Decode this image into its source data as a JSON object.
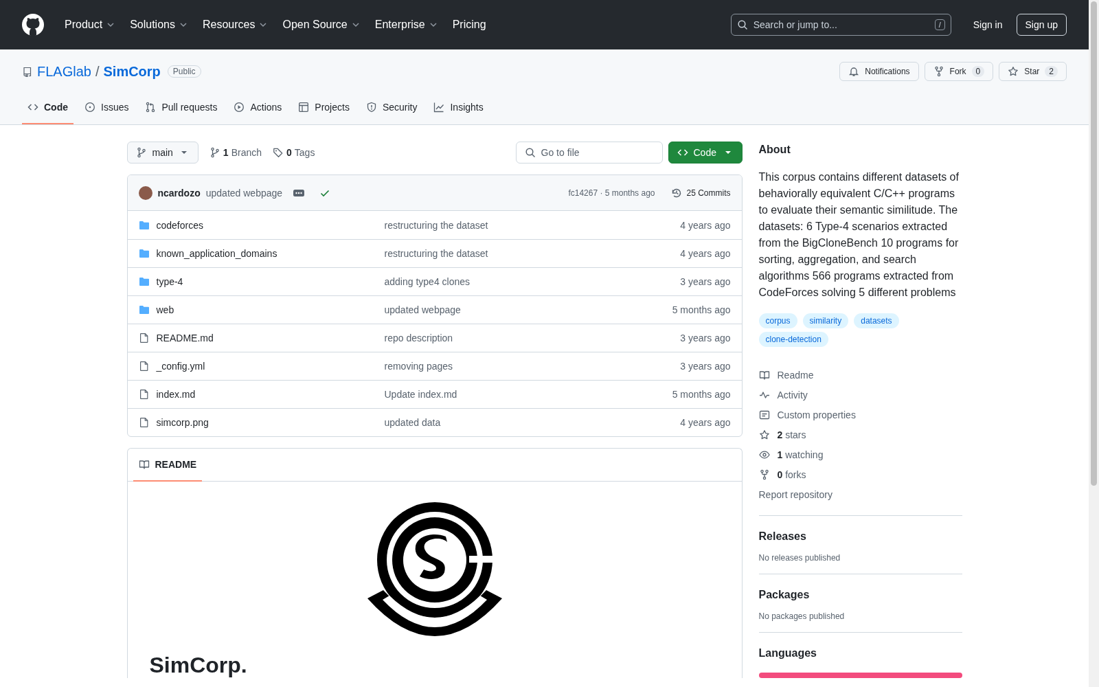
{
  "header": {
    "nav": [
      {
        "label": "Product",
        "menu": true
      },
      {
        "label": "Solutions",
        "menu": true
      },
      {
        "label": "Resources",
        "menu": true
      },
      {
        "label": "Open Source",
        "menu": true
      },
      {
        "label": "Enterprise",
        "menu": true
      },
      {
        "label": "Pricing",
        "menu": false
      }
    ],
    "search": {
      "placeholder": "Search or jump to...",
      "shortcut": "/"
    },
    "sign_in": "Sign in",
    "sign_up": "Sign up"
  },
  "repo": {
    "owner": "FLAGlab",
    "separator": "/",
    "name": "SimCorp",
    "visibility": "Public",
    "actions": [
      {
        "kind": "notifications",
        "label": "Notifications"
      },
      {
        "kind": "fork",
        "label": "Fork",
        "count": "0"
      },
      {
        "kind": "star",
        "label": "Star",
        "count": "2"
      }
    ],
    "tabs": [
      {
        "kind": "code",
        "label": "Code",
        "selected": true
      },
      {
        "kind": "issues",
        "label": "Issues",
        "selected": false
      },
      {
        "kind": "pulls",
        "label": "Pull requests",
        "selected": false
      },
      {
        "kind": "actions",
        "label": "Actions",
        "selected": false
      },
      {
        "kind": "projects",
        "label": "Projects",
        "selected": false
      },
      {
        "kind": "security",
        "label": "Security",
        "selected": false
      },
      {
        "kind": "insights",
        "label": "Insights",
        "selected": false
      }
    ]
  },
  "toolbar": {
    "branch": "main",
    "branches": {
      "count": "1",
      "label": "Branch"
    },
    "tags": {
      "count": "0",
      "label": "Tags"
    },
    "go_to_file": {
      "placeholder": "Go to file"
    },
    "code_button": "Code"
  },
  "commit": {
    "author": "ncardozo",
    "message": "updated webpage",
    "checks_passed": true,
    "meta": "fc14267 · 5 months ago",
    "commits": "25 Commits"
  },
  "files": [
    {
      "kind": "folder",
      "name": "codeforces",
      "message": "restructuring the dataset",
      "age": "4 years ago"
    },
    {
      "kind": "folder",
      "name": "known_application_domains",
      "message": "restructuring the dataset",
      "age": "4 years ago"
    },
    {
      "kind": "folder",
      "name": "type-4",
      "message": "adding type4 clones",
      "age": "3 years ago"
    },
    {
      "kind": "folder",
      "name": "web",
      "message": "updated webpage",
      "age": "5 months ago"
    },
    {
      "kind": "file",
      "name": "README.md",
      "message": "repo description",
      "age": "3 years ago"
    },
    {
      "kind": "file",
      "name": "_config.yml",
      "message": "removing pages",
      "age": "3 years ago"
    },
    {
      "kind": "file",
      "name": "index.md",
      "message": "Update index.md",
      "age": "5 months ago"
    },
    {
      "kind": "file",
      "name": "simcorp.png",
      "message": "updated data",
      "age": "4 years ago"
    }
  ],
  "readme": {
    "tab": "README",
    "heading": "SimCorp."
  },
  "sidebar": {
    "about_title": "About",
    "description": "This corpus contains different datasets of behaviorally equivalent C/C++ programs to evaluate their semantic similitude. The datasets: 6 Type-4 scenarios extracted from the BigCloneBench 10 programs for sorting, aggregation, and search algorithms 566 programs extracted from CodeForces solving 5 different problems",
    "topics": [
      "corpus",
      "similarity",
      "datasets",
      "clone-detection"
    ],
    "links": [
      {
        "kind": "readme",
        "label": "Readme"
      },
      {
        "kind": "activity",
        "label": "Activity"
      },
      {
        "kind": "properties",
        "label": "Custom properties"
      },
      {
        "kind": "stars",
        "count": "2",
        "label": "stars"
      },
      {
        "kind": "watching",
        "count": "1",
        "label": "watching"
      },
      {
        "kind": "forks",
        "count": "0",
        "label": "forks"
      }
    ],
    "report": "Report repository",
    "sections": [
      {
        "title": "Releases",
        "note": "No releases published"
      },
      {
        "title": "Packages",
        "note": "No packages published"
      }
    ],
    "languages": {
      "title": "Languages",
      "segments": [
        {
          "color": "#f34b7d",
          "level": 1
        }
      ]
    }
  }
}
